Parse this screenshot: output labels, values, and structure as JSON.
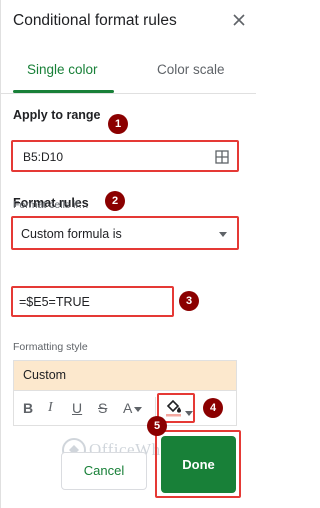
{
  "header": {
    "title": "Conditional format rules",
    "close_icon": "close-icon"
  },
  "tabs": [
    {
      "label": "Single color",
      "active": true
    },
    {
      "label": "Color scale",
      "active": false
    }
  ],
  "range": {
    "heading": "Apply to range",
    "value": "B5:D10",
    "icon": "grid-icon"
  },
  "rules": {
    "heading": "Format rules",
    "condition_label": "Format cells if…",
    "condition_value": "Custom formula is",
    "formula_value": "=$E5=TRUE"
  },
  "style": {
    "heading": "Formatting style",
    "preview_label": "Custom",
    "preview_color": "#fce8cd",
    "toolbar": {
      "bold": "B",
      "italic": "I",
      "underline": "U",
      "strike": "S",
      "text_color": "A"
    }
  },
  "buttons": {
    "cancel": "Cancel",
    "done": "Done"
  },
  "badges": [
    "1",
    "2",
    "3",
    "4",
    "5"
  ],
  "watermark": "OfficeWheel",
  "colors": {
    "accent": "#188038",
    "highlight": "#e53935",
    "badge": "#8b0000"
  }
}
